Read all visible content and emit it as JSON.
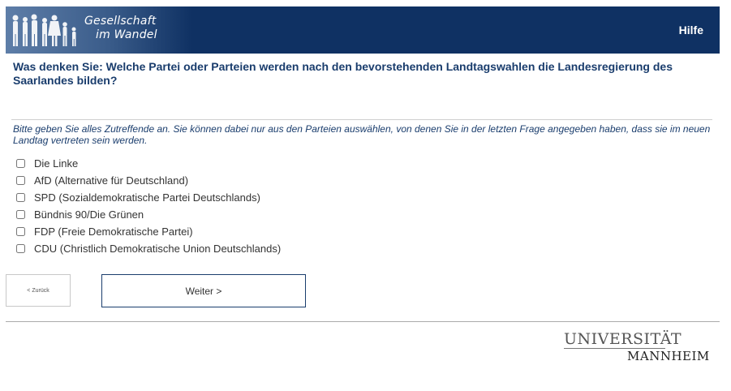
{
  "header": {
    "logo": {
      "line1": "Gesellschaft",
      "line2": "im Wandel"
    },
    "help_label": "Hilfe"
  },
  "question": {
    "text": "Was denken Sie: Welche Partei oder Parteien werden nach den bevorstehenden Landtagswahlen die Landesregierung des Saarlandes bilden?",
    "instruction": "Bitte geben Sie alles Zutreffende an. Sie können dabei nur aus den Parteien auswählen, von denen Sie in der letzten Frage angegeben haben, dass sie im neuen Landtag vertreten sein werden."
  },
  "options": [
    {
      "label": "Die Linke",
      "checked": false
    },
    {
      "label": "AfD (Alternative für Deutschland)",
      "checked": false
    },
    {
      "label": "SPD (Sozialdemokratische Partei Deutschlands)",
      "checked": false
    },
    {
      "label": "Bündnis 90/Die Grünen",
      "checked": false
    },
    {
      "label": "FDP (Freie Demokratische Partei)",
      "checked": false
    },
    {
      "label": "CDU (Christlich Demokratische Union Deutschlands)",
      "checked": false
    }
  ],
  "navigation": {
    "back_label": "< Zurück",
    "next_label": "Weiter >"
  },
  "footer": {
    "university_line1": "UNIVERSITÄT",
    "university_line2": "MANNHEIM"
  },
  "colors": {
    "header_bg": "#0f3163",
    "accent_text": "#1a3d6d"
  }
}
